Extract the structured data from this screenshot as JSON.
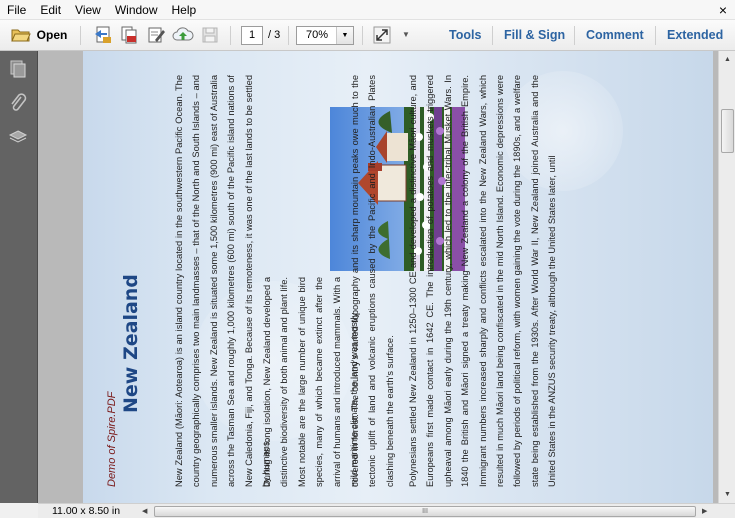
{
  "menu": [
    "File",
    "Edit",
    "View",
    "Window",
    "Help"
  ],
  "close_glyph": "×",
  "toolbar": {
    "open_label": "Open",
    "page_current": "1",
    "page_total": "/ 3",
    "zoom": "70%",
    "tools": [
      "Tools",
      "Fill & Sign",
      "Comment",
      "Extended"
    ]
  },
  "icons": {
    "open": "folder-open-icon",
    "create": "create-pdf-icon",
    "combine": "combine-files-icon",
    "sign": "sign-icon",
    "upload": "cloud-upload-icon",
    "save": "save-icon",
    "expand": "fit-window-icon",
    "pages": "page-thumbnails-icon",
    "attachments": "paperclip-icon",
    "layers": "layers-icon"
  },
  "document": {
    "title": "New Zealand",
    "demo_tag": "Demo of Spire.PDF",
    "para1": "New Zealand (Māori: Aotearoa) is an island country located in the southwestern Pacific Ocean. The country geographically comprises two main landmasses – that of the North and South Islands – and numerous smaller islands. New Zealand is situated some 1,500 kilometres (900 mi) east of Australia across the Tasman Sea and roughly 1,000 kilometres (600 mi) south of the Pacific island nations of New Caledonia, Fiji, and Tonga. Because of its remoteness, it was one of the last lands to be settled by humans.",
    "para2a": "During its long isolation, New Zealand developed a distinctive biodiversity of both animal and plant life. Most notable are the large number of unique bird species, many of which became extinct after the arrival of humans and introduced mammals. With a mild maritime climate, the land was mostly",
    "para2b": "covered in forest. The country's varied topography and its sharp mountain peaks owe much to the tectonic uplift of land and volcanic eruptions caused by the Pacific and Indo-Australian Plates clashing beneath the earth's surface.",
    "para3": "Polynesians settled New Zealand in 1250–1300 CE and developed a distinctive Māori culture, and Europeans first made contact in 1642 CE. The introduction of potatoes and muskets triggered upheaval among Māori early during the 19th century, which led to the inter-tribal Musket Wars. In 1840 the British and Māori signed a treaty making New Zealand a colony of the British Empire. Immigrant numbers increased sharply and conflicts escalated into the New Zealand Wars, which resulted in much Māori land being confiscated in the mid North Island. Economic depressions were followed by periods of political reform, with women gaining the vote during the 1890s, and a welfare state being established from the 1930s. After World War II, New Zealand joined Australia and the United States in the ANZUS security treaty, although the United States later, until"
  },
  "status": {
    "page_size": "11.00 x 8.50 in",
    "grip": "III"
  }
}
